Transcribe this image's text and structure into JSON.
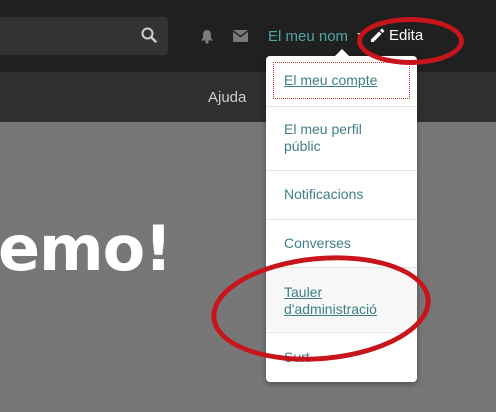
{
  "header": {
    "username": "El meu nom",
    "edit_label": "Edita",
    "icons": {
      "search": "search-icon",
      "notifications": "bell-icon",
      "messages": "mail-icon",
      "dropdown": "caret-down-icon",
      "edit": "pencil-icon"
    }
  },
  "nav": {
    "help_label": "Ajuda"
  },
  "hero": {
    "text": "emo!"
  },
  "user_menu": {
    "items": [
      {
        "label": "El meu compte"
      },
      {
        "label": "El meu perfil públic"
      },
      {
        "label": "Notificacions"
      },
      {
        "label": "Converses"
      },
      {
        "label": "Tauler d'administració"
      },
      {
        "label": "Surt"
      }
    ]
  },
  "colors": {
    "link": "#3c7f84",
    "annotation": "#c8141b",
    "topbar": "#202020"
  }
}
